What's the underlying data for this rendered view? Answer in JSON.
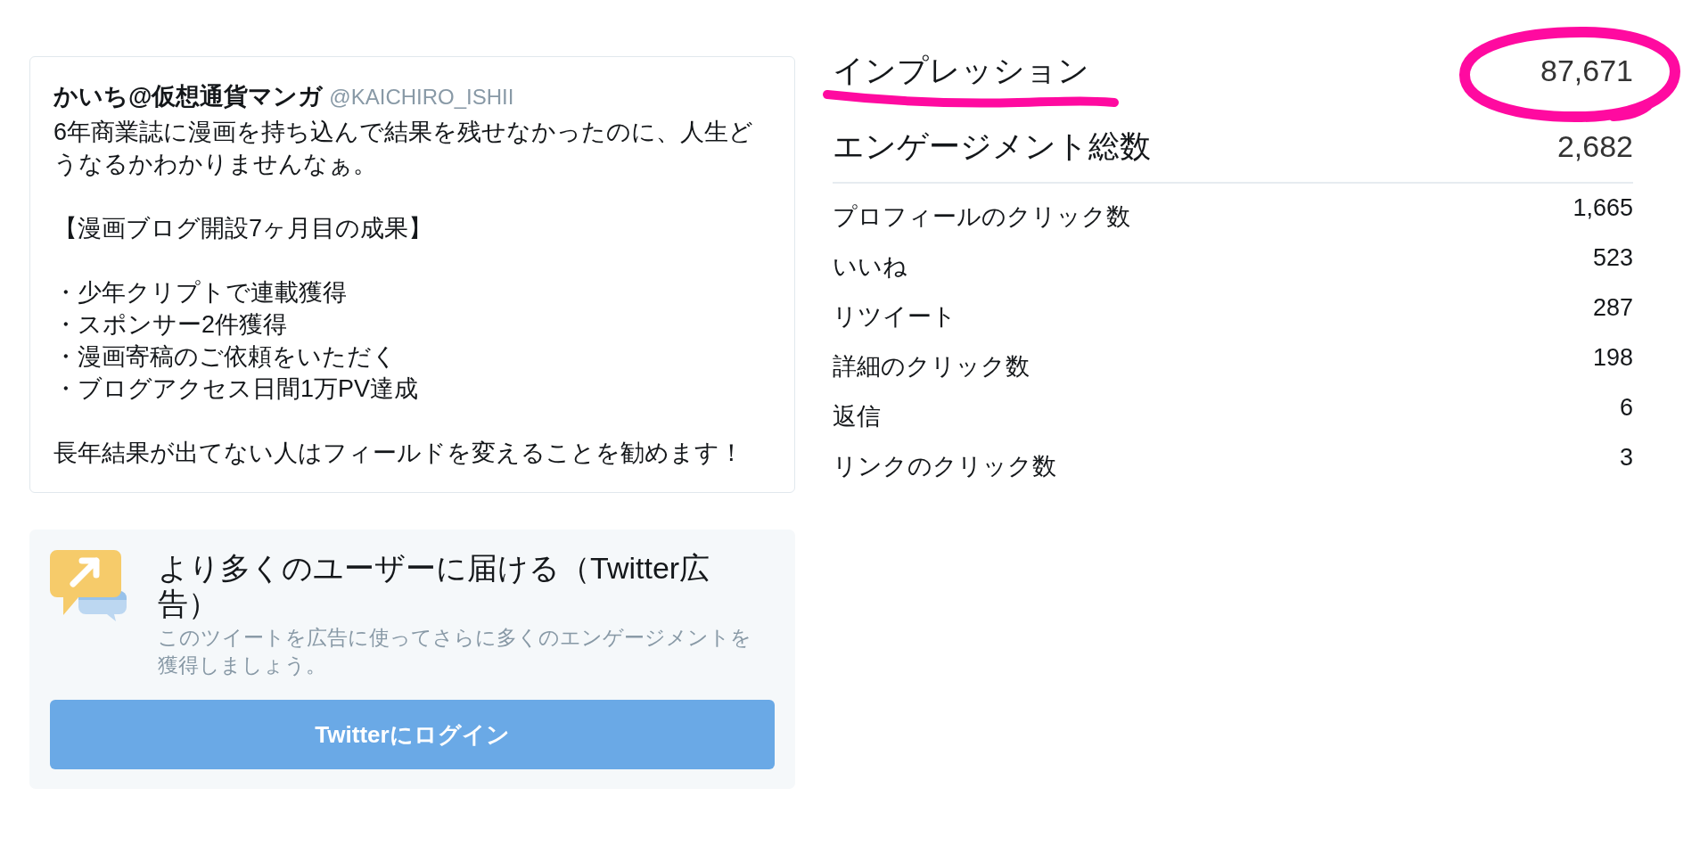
{
  "tweet": {
    "author_name": "かいち@仮想通貨マンガ",
    "author_handle": "@KAICHIRO_ISHII",
    "paragraphs": [
      {
        "lines": [
          "6年商業誌に漫画を持ち込んで結果を残せなかったのに、人生どうなるかわかりませんなぁ。"
        ]
      },
      {
        "lines": [
          "【漫画ブログ開設7ヶ月目の成果】"
        ]
      },
      {
        "lines": [
          "・少年クリプトで連載獲得",
          "・スポンサー2件獲得",
          "・漫画寄稿のご依頼をいただく",
          "・ブログアクセス日間1万PV達成"
        ]
      },
      {
        "lines": [
          "長年結果が出てない人はフィールドを変えることを勧めます！"
        ]
      }
    ]
  },
  "promo": {
    "title": "より多くのユーザーに届ける（Twitter広告）",
    "description": "このツイートを広告に使ってさらに多くのエンゲージメントを獲得しましょう。",
    "button": "Twitterにログイン"
  },
  "headline_metrics": [
    {
      "label": "インプレッション",
      "value": "87,671",
      "underlined": true,
      "circled": true
    },
    {
      "label": "エンゲージメント総数",
      "value": "2,682",
      "underlined": false,
      "circled": false
    }
  ],
  "metrics": [
    {
      "label": "プロフィールのクリック数",
      "value": "1,665"
    },
    {
      "label": "いいね",
      "value": "523"
    },
    {
      "label": "リツイート",
      "value": "287"
    },
    {
      "label": "詳細のクリック数",
      "value": "198"
    },
    {
      "label": "返信",
      "value": "6"
    },
    {
      "label": "リンクのクリック数",
      "value": "3"
    }
  ]
}
